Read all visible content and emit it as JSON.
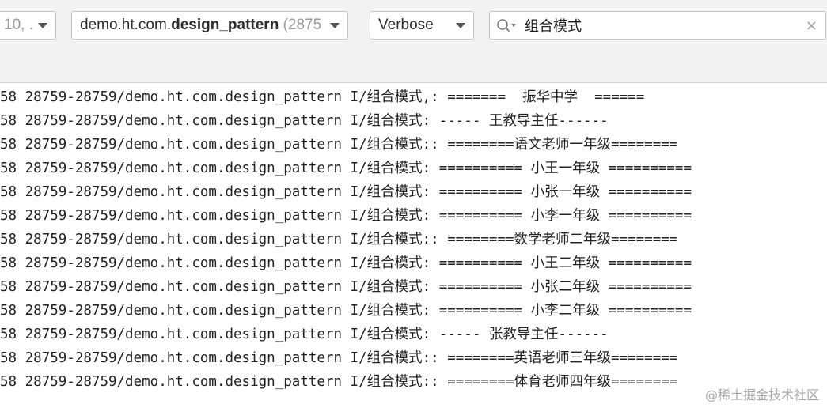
{
  "toolbar": {
    "device_select": {
      "value": "10, ."
    },
    "process_select": {
      "package_prefix": "demo.ht.com.",
      "package_name": "design_pattern",
      "pid": "(2875"
    },
    "level_select": {
      "value": "Verbose"
    },
    "search": {
      "value": "组合模式",
      "clear_icon": "×"
    }
  },
  "log_lines": [
    {
      "prefix": "58",
      "process": "28759-28759/demo.ht.com.design_pattern",
      "tag": "I/组合模式",
      "message": ",: =======  振华中学  ======"
    },
    {
      "prefix": "58",
      "process": "28759-28759/demo.ht.com.design_pattern",
      "tag": "I/组合模式",
      "message": ": ----- 王教导主任------"
    },
    {
      "prefix": "58",
      "process": "28759-28759/demo.ht.com.design_pattern",
      "tag": "I/组合模式",
      "message": ":: ========语文老师一年级========"
    },
    {
      "prefix": "58",
      "process": "28759-28759/demo.ht.com.design_pattern",
      "tag": "I/组合模式",
      "message": ": ========== 小王一年级 =========="
    },
    {
      "prefix": "58",
      "process": "28759-28759/demo.ht.com.design_pattern",
      "tag": "I/组合模式",
      "message": ": ========== 小张一年级 =========="
    },
    {
      "prefix": "58",
      "process": "28759-28759/demo.ht.com.design_pattern",
      "tag": "I/组合模式",
      "message": ": ========== 小李一年级 =========="
    },
    {
      "prefix": "58",
      "process": "28759-28759/demo.ht.com.design_pattern",
      "tag": "I/组合模式",
      "message": ":: ========数学老师二年级========"
    },
    {
      "prefix": "58",
      "process": "28759-28759/demo.ht.com.design_pattern",
      "tag": "I/组合模式",
      "message": ": ========== 小王二年级 =========="
    },
    {
      "prefix": "58",
      "process": "28759-28759/demo.ht.com.design_pattern",
      "tag": "I/组合模式",
      "message": ": ========== 小张二年级 =========="
    },
    {
      "prefix": "58",
      "process": "28759-28759/demo.ht.com.design_pattern",
      "tag": "I/组合模式",
      "message": ": ========== 小李二年级 =========="
    },
    {
      "prefix": "58",
      "process": "28759-28759/demo.ht.com.design_pattern",
      "tag": "I/组合模式",
      "message": ": ----- 张教导主任------"
    },
    {
      "prefix": "58",
      "process": "28759-28759/demo.ht.com.design_pattern",
      "tag": "I/组合模式",
      "message": ":: ========英语老师三年级========"
    },
    {
      "prefix": "58",
      "process": "28759-28759/demo.ht.com.design_pattern",
      "tag": "I/组合模式",
      "message": ":: ========体育老师四年级========"
    }
  ],
  "watermark": "@稀土掘金技术社区",
  "icons": {
    "search": "search-icon",
    "dropdown": "chevron-down-icon",
    "clear": "close-icon"
  },
  "colors": {
    "toolbar_background": "#f2f2f2",
    "log_text": "#222222",
    "muted_text": "#9a9a9a"
  }
}
